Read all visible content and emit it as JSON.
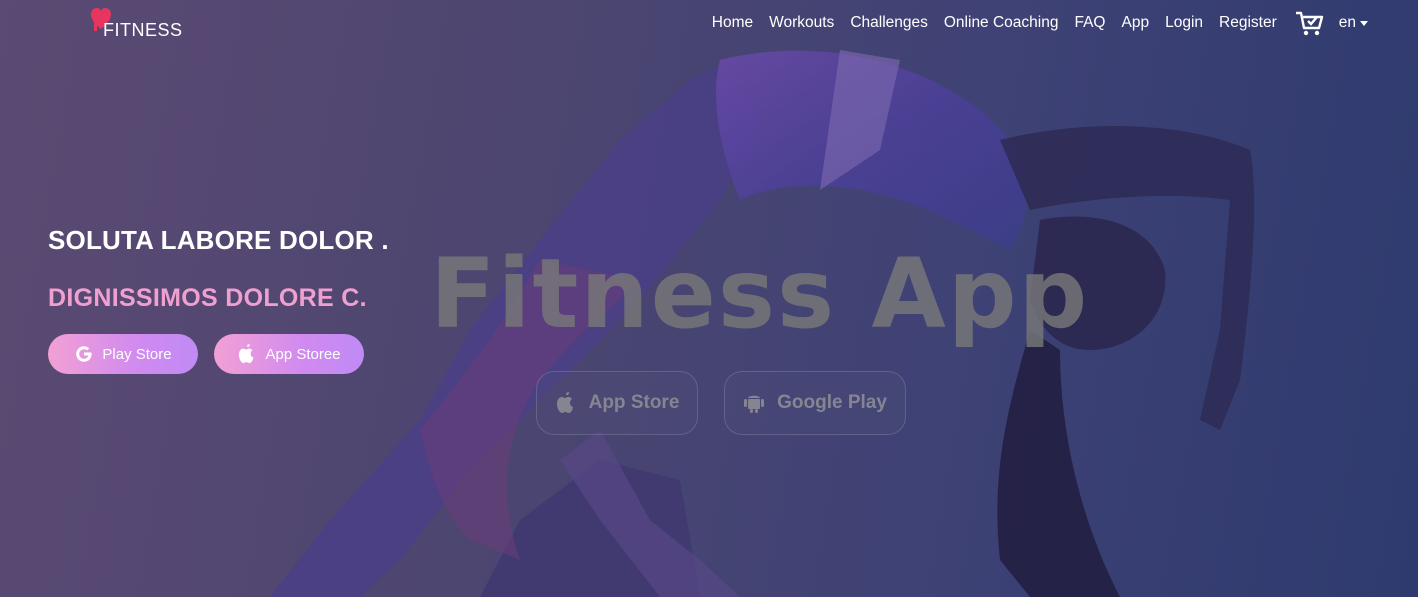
{
  "brand": {
    "logo_text": "FITNESS",
    "accent": "#e8355f"
  },
  "nav": {
    "items": [
      "Home",
      "Workouts",
      "Challenges",
      "Online Coaching",
      "FAQ",
      "App",
      "Login",
      "Register"
    ],
    "cart_icon": "shopping-cart-icon",
    "language": "en"
  },
  "hero": {
    "headline": "SOLUTA LABORE DOLOR .",
    "subheadline": "DIGNISSIMOS DOLORE C.",
    "subheadline_color": "#f0a0d0",
    "buttons": [
      {
        "label": "Play Store",
        "icon": "google-icon"
      },
      {
        "label": "App Storee",
        "icon": "apple-icon"
      }
    ],
    "background_title": "Fitness App",
    "background_buttons": [
      {
        "label": "App Store",
        "icon": "apple-icon"
      },
      {
        "label": "Google Play",
        "icon": "android-icon"
      }
    ]
  }
}
